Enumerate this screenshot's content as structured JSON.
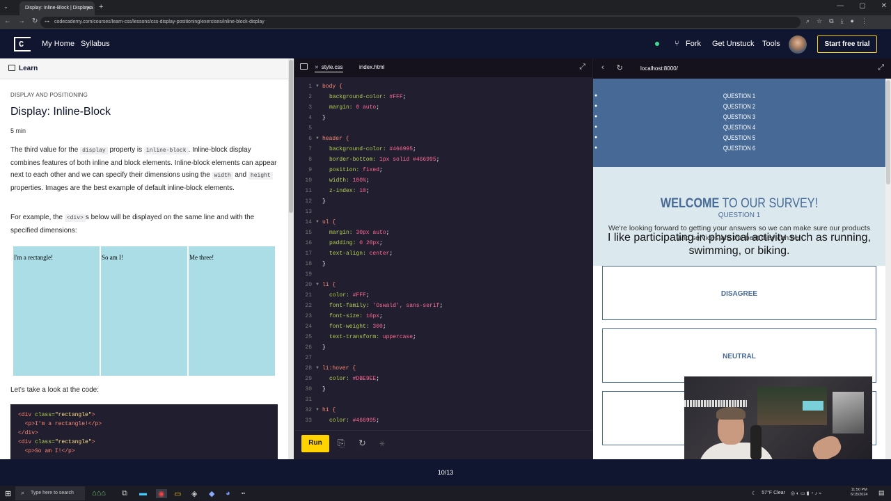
{
  "browser": {
    "tab_title": "Display: Inline-Block | Display a",
    "tab_close": "✕",
    "new_tab": "+",
    "url": "codecademy.com/courses/learn-css/lessons/css-display-positioning/exercises/inline-block-display",
    "window_controls": [
      "—",
      "▢",
      "✕"
    ]
  },
  "header": {
    "logo": "C|",
    "nav": [
      "My Home",
      "Syllabus"
    ],
    "right": [
      "Fork",
      "Get Unstuck",
      "Tools"
    ],
    "cta": "Start free trial"
  },
  "learn": {
    "panel_label": "Learn",
    "kicker": "DISPLAY AND POSITIONING",
    "title": "Display: Inline-Block",
    "duration": "5 min",
    "p1_a": "The third value for the ",
    "p1_code1": "display",
    "p1_b": " property is ",
    "p1_code2": "inline-block",
    "p1_c": ". Inline-block display combines features of both inline and block elements. Inline-block elements can appear next to each other and we can specify their dimensions using the ",
    "p1_code3": "width",
    "p1_d": " and ",
    "p1_code4": "height",
    "p1_e": " properties. Images are the best example of default inline-block elements.",
    "p2_a": "For example, the ",
    "p2_code": "<div>",
    "p2_b": "s below will be displayed on the same line and with the specified dimensions:",
    "rects": [
      "I'm a rectangle!",
      "So am I!",
      "Me three!"
    ],
    "p3": "Let's take a look at the code:",
    "code_lines": [
      {
        "open": "<div ",
        "attr": "class=",
        "str": "\"rectangle\"",
        "close": ">"
      },
      {
        "text": "  <p>I'm a rectangle!</p>"
      },
      {
        "text": "</div>"
      },
      {
        "open": "<div ",
        "attr": "class=",
        "str": "\"rectangle\"",
        "close": ">"
      },
      {
        "text": "  <p>So am I!</p>"
      }
    ]
  },
  "editor": {
    "tabs": [
      "style.css",
      "index.html"
    ],
    "run_label": "Run",
    "lines": [
      {
        "n": "1",
        "sel": "body {",
        "fold": true
      },
      {
        "n": "2",
        "prop": "background-color: ",
        "val": "#FFF",
        "end": ";"
      },
      {
        "n": "3",
        "prop": "margin: ",
        "val": "0 auto",
        "end": ";"
      },
      {
        "n": "4",
        "p": "}"
      },
      {
        "n": "5"
      },
      {
        "n": "6",
        "sel": "header {",
        "fold": true
      },
      {
        "n": "7",
        "prop": "background-color: ",
        "val": "#466995",
        "end": ";"
      },
      {
        "n": "8",
        "prop": "border-bottom: ",
        "val": "1px solid #466995",
        "end": ";"
      },
      {
        "n": "9",
        "prop": "position: ",
        "val": "fixed",
        "end": ";"
      },
      {
        "n": "10",
        "prop": "width: ",
        "val": "100%",
        "end": ";"
      },
      {
        "n": "11",
        "prop": "z-index: ",
        "val": "10",
        "end": ";"
      },
      {
        "n": "12",
        "p": "}"
      },
      {
        "n": "13"
      },
      {
        "n": "14",
        "sel": "ul {",
        "fold": true
      },
      {
        "n": "15",
        "prop": "margin: ",
        "val": "30px auto",
        "end": ";"
      },
      {
        "n": "16",
        "prop": "padding: ",
        "val": "0 20px",
        "end": ";"
      },
      {
        "n": "17",
        "prop": "text-align: ",
        "val": "center",
        "end": ";"
      },
      {
        "n": "18",
        "p": "}"
      },
      {
        "n": "19"
      },
      {
        "n": "20",
        "sel": "li {",
        "fold": true
      },
      {
        "n": "21",
        "prop": "color: ",
        "val": "#FFF",
        "end": ";"
      },
      {
        "n": "22",
        "prop": "font-family: ",
        "val": "'Oswald', sans-serif",
        "end": ";"
      },
      {
        "n": "23",
        "prop": "font-size: ",
        "val": "16px",
        "end": ";"
      },
      {
        "n": "24",
        "prop": "font-weight: ",
        "val": "300",
        "end": ";"
      },
      {
        "n": "25",
        "prop": "text-transform: ",
        "val": "uppercase",
        "end": ";"
      },
      {
        "n": "26",
        "p": "}"
      },
      {
        "n": "27"
      },
      {
        "n": "28",
        "sel": "li:hover {",
        "fold": true
      },
      {
        "n": "29",
        "prop": "color: ",
        "val": "#DBE9EE",
        "end": ";"
      },
      {
        "n": "30",
        "p": "}"
      },
      {
        "n": "31"
      },
      {
        "n": "32",
        "sel": "h1 {",
        "fold": true
      },
      {
        "n": "33",
        "prop": "color: ",
        "val": "#466995",
        "end": ";"
      }
    ]
  },
  "preview": {
    "url": "localhost:8000/",
    "questions": [
      "QUESTION 1",
      "QUESTION 2",
      "QUESTION 3",
      "QUESTION 4",
      "QUESTION 5",
      "QUESTION 6"
    ],
    "welcome_bold": "WELCOME",
    "welcome_rest": " TO OUR SURVEY!",
    "question_label": "QUESTION 1",
    "intro": "We're looking forward to getting your answers so we can make sure our products and services are the best they can be!",
    "prompt": "I like participating in physical activity such as running, swimming, or biking.",
    "options": [
      "DISAGREE",
      "NEUTRAL",
      ""
    ]
  },
  "footer": {
    "progress": "10/13"
  },
  "taskbar": {
    "search_placeholder": "Type here to search",
    "weather": "57°F  Clear",
    "time": "11:50 PM",
    "date": "6/15/2024"
  },
  "colors": {
    "brand_dark": "#10162f",
    "cta_yellow": "#ffd300",
    "survey_blue": "#466995",
    "survey_light": "#dbe9ee",
    "rect_fill": "#aadde6"
  }
}
